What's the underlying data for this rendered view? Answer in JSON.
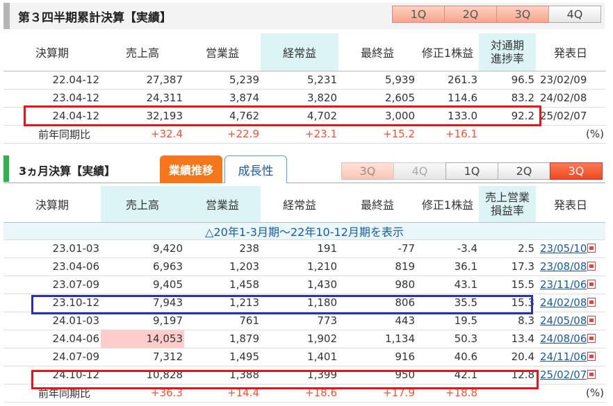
{
  "cumulative": {
    "title": "第３四半期累計決算【実績】",
    "tabs": [
      "1Q",
      "2Q",
      "3Q",
      "4Q"
    ],
    "headers": {
      "period": "決算期",
      "sales": "売上高",
      "op": "営業益",
      "ord": "経常益",
      "net": "最終益",
      "eps": "修正1株益",
      "ratio1": "対通期",
      "ratio2": "進捗率",
      "date": "発表日"
    },
    "rows": [
      {
        "period": "22.04-12",
        "sales": "27,387",
        "op": "5,239",
        "ord": "5,231",
        "net": "5,939",
        "eps": "261.3",
        "ratio": "96.5",
        "date": "23/02/09"
      },
      {
        "period": "23.04-12",
        "sales": "24,311",
        "op": "3,874",
        "ord": "3,820",
        "net": "2,605",
        "eps": "114.6",
        "ratio": "83.2",
        "date": "24/02/08"
      },
      {
        "period": "24.04-12",
        "sales": "32,193",
        "op": "4,762",
        "ord": "4,702",
        "net": "3,000",
        "eps": "133.0",
        "ratio": "92.2",
        "date": "25/02/07"
      }
    ],
    "yoy": {
      "label": "前年同期比",
      "sales": "+32.4",
      "op": "+22.9",
      "ord": "+23.1",
      "net": "+15.2",
      "eps": "+16.1",
      "unit": "(%)"
    }
  },
  "quarterly": {
    "title": "3ヵ月決算【実績】",
    "tab_trend": "業績推移",
    "tab_growth": "成長性",
    "tabs": [
      "3Q",
      "4Q",
      "1Q",
      "2Q",
      "3Q"
    ],
    "headers": {
      "period": "決算期",
      "sales": "売上高",
      "op": "営業益",
      "ord": "経常益",
      "net": "最終益",
      "eps": "修正1株益",
      "margin1": "売上営業",
      "margin2": "損益率",
      "date": "発表日"
    },
    "toggle": "△20年1-3月期～22年10-12月期を表示",
    "rows": [
      {
        "period": "23.01-03",
        "sales": "9,420",
        "op": "238",
        "ord": "191",
        "net": "-77",
        "eps": "-3.4",
        "margin": "2.5",
        "date": "23/05/10"
      },
      {
        "period": "23.04-06",
        "sales": "6,963",
        "op": "1,203",
        "ord": "1,210",
        "net": "819",
        "eps": "36.1",
        "margin": "17.3",
        "date": "23/08/08"
      },
      {
        "period": "23.07-09",
        "sales": "9,405",
        "op": "1,458",
        "ord": "1,430",
        "net": "980",
        "eps": "43.1",
        "margin": "15.5",
        "date": "23/11/06"
      },
      {
        "period": "23.10-12",
        "sales": "7,943",
        "op": "1,213",
        "ord": "1,180",
        "net": "806",
        "eps": "35.5",
        "margin": "15.3",
        "date": "24/02/08"
      },
      {
        "period": "24.01-03",
        "sales": "9,197",
        "op": "761",
        "ord": "773",
        "net": "443",
        "eps": "19.5",
        "margin": "8.3",
        "date": "24/05/08"
      },
      {
        "period": "24.04-06",
        "sales": "14,053",
        "op": "1,879",
        "ord": "1,902",
        "net": "1,134",
        "eps": "50.3",
        "margin": "13.4",
        "date": "24/08/06"
      },
      {
        "period": "24.07-09",
        "sales": "7,312",
        "op": "1,495",
        "ord": "1,401",
        "net": "916",
        "eps": "40.6",
        "margin": "20.4",
        "date": "24/11/06"
      },
      {
        "period": "24.10-12",
        "sales": "10,828",
        "op": "1,388",
        "ord": "1,399",
        "net": "950",
        "eps": "42.1",
        "margin": "12.8",
        "date": "25/02/07"
      }
    ],
    "yoy": {
      "label": "前年同期比",
      "sales": "+36.3",
      "op": "+14.4",
      "ord": "+18.6",
      "net": "+17.9",
      "eps": "+18.8",
      "unit": "(%)"
    }
  },
  "colors": {
    "highlight_red": "#e8141c",
    "highlight_blue": "#2731b8",
    "accent_orange": "#f6761a",
    "plus": "#ee5533"
  }
}
